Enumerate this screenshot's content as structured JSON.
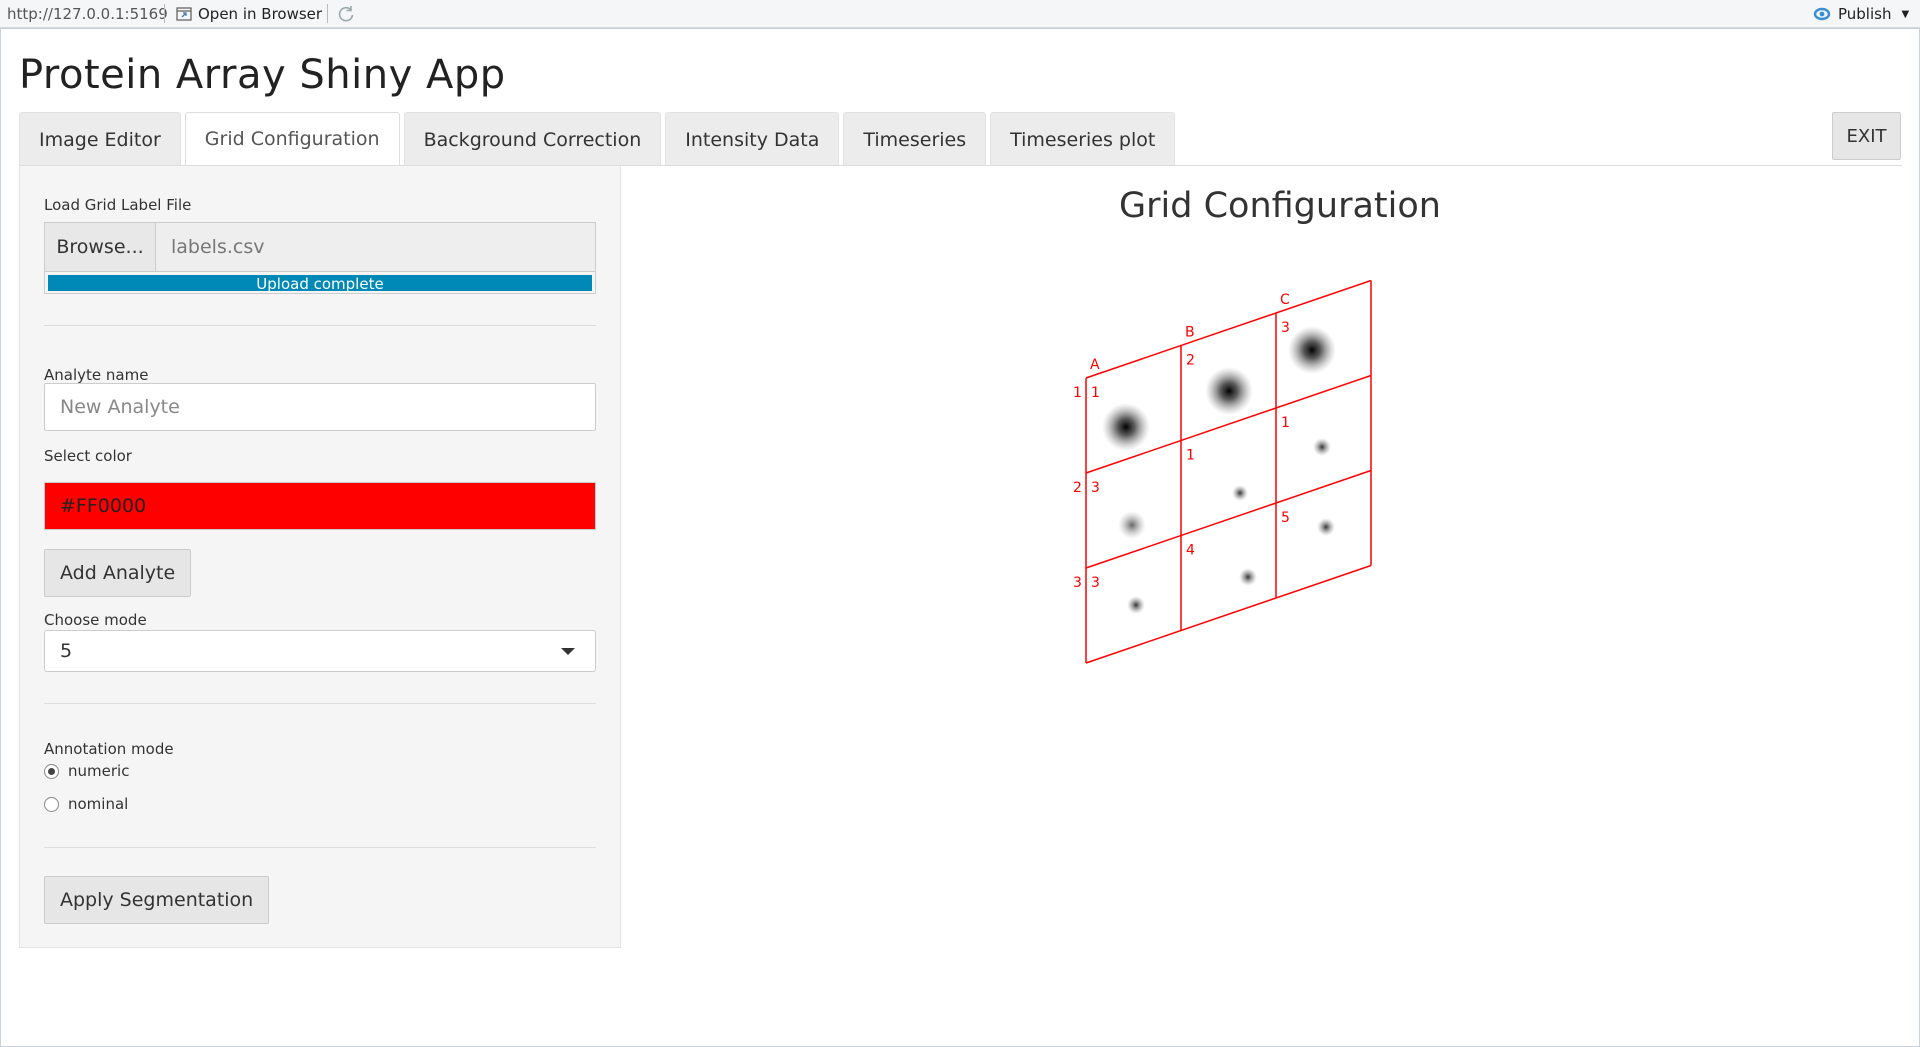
{
  "viewer": {
    "url": "http://127.0.0.1:5169",
    "open_in_browser": "Open in Browser",
    "publish": "Publish"
  },
  "app": {
    "title": "Protein Array Shiny App"
  },
  "tabs": [
    {
      "label": "Image Editor",
      "active": false
    },
    {
      "label": "Grid Configuration",
      "active": true
    },
    {
      "label": "Background Correction",
      "active": false
    },
    {
      "label": "Intensity Data",
      "active": false
    },
    {
      "label": "Timeseries",
      "active": false
    },
    {
      "label": "Timeseries plot",
      "active": false
    }
  ],
  "exit_label": "EXIT",
  "sidebar": {
    "grid_label_file": {
      "label": "Load Grid Label File",
      "browse": "Browse...",
      "file_name": "labels.csv",
      "progress_text": "Upload complete",
      "progress": 1.0
    },
    "analyte": {
      "label": "Analyte name",
      "placeholder": "New Analyte",
      "value": ""
    },
    "color": {
      "label": "Select color",
      "value": "#FF0000",
      "swatch": "#ff0000"
    },
    "add_analyte": "Add Analyte",
    "mode": {
      "label": "Choose mode",
      "selected": "5"
    },
    "annotation": {
      "label": "Annotation mode",
      "options": [
        {
          "label": "numeric",
          "checked": true
        },
        {
          "label": "nominal",
          "checked": false
        }
      ]
    },
    "apply_segmentation": "Apply Segmentation"
  },
  "main": {
    "plot_title": "Grid Configuration",
    "grid": {
      "columns": [
        "A",
        "B",
        "C"
      ],
      "rows": [
        "1",
        "2",
        "3"
      ],
      "cell_labels": [
        [
          "1",
          "2",
          "3"
        ],
        [
          "3",
          "1",
          "1"
        ],
        [
          "3",
          "4",
          "5"
        ]
      ],
      "line_color": "#ff0000"
    }
  },
  "icons": {
    "open_in_browser": "browser-window-icon",
    "refresh": "refresh-icon",
    "publish": "publish-icon"
  }
}
